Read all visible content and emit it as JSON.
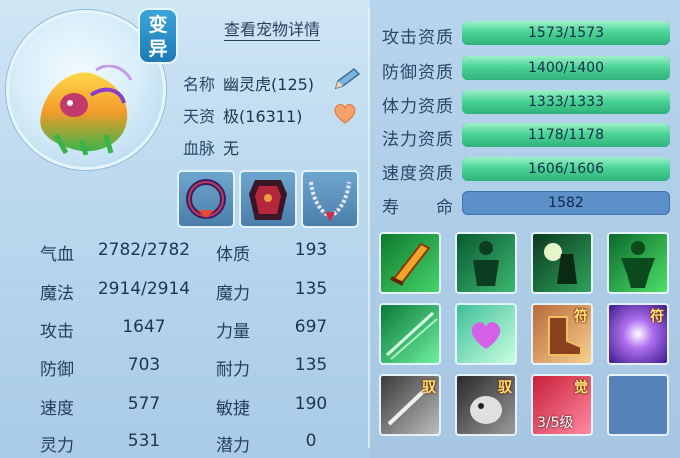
{
  "pet": {
    "mutation_badge": "变异",
    "detail_link": "查看宠物详情",
    "name_label": "名称",
    "name_value": "幽灵虎(125)",
    "aptitude_label": "天资",
    "aptitude_value": "极(16311)",
    "bloodline_label": "血脉",
    "bloodline_value": "无"
  },
  "stats": {
    "hp_label": "气血",
    "hp_value": "2782/2782",
    "mp_label": "魔法",
    "mp_value": "2914/2914",
    "atk_label": "攻击",
    "atk_value": "1647",
    "def_label": "防御",
    "def_value": "703",
    "spd_label": "速度",
    "spd_value": "577",
    "spirit_label": "灵力",
    "spirit_value": "531",
    "con_label": "体质",
    "con_value": "193",
    "int_label": "魔力",
    "int_value": "135",
    "str_label": "力量",
    "str_value": "697",
    "end_label": "耐力",
    "end_value": "135",
    "agi_label": "敏捷",
    "agi_value": "190",
    "pot_label": "潜力",
    "pot_value": "0"
  },
  "aptitudes": [
    {
      "label": "攻击资质",
      "text": "1573/1573",
      "fill": 1.0
    },
    {
      "label": "防御资质",
      "text": "1400/1400",
      "fill": 1.0
    },
    {
      "label": "体力资质",
      "text": "1333/1333",
      "fill": 1.0
    },
    {
      "label": "法力资质",
      "text": "1178/1178",
      "fill": 1.0
    },
    {
      "label": "速度资质",
      "text": "1606/1606",
      "fill": 1.0
    },
    {
      "label": "寿　　命",
      "text": "1582",
      "fill": 0
    }
  ],
  "skills": [
    {
      "icon": "flaming-sword-icon"
    },
    {
      "icon": "green-figure-icon"
    },
    {
      "icon": "moon-warrior-icon"
    },
    {
      "icon": "muscle-figure-icon"
    },
    {
      "icon": "green-burst-icon"
    },
    {
      "icon": "heart-glow-icon"
    },
    {
      "icon": "boot-icon",
      "tag": "符"
    },
    {
      "icon": "purple-burst-icon",
      "tag": "符"
    },
    {
      "icon": "grey-slash-icon",
      "tag": "驭"
    },
    {
      "icon": "grey-beast-icon",
      "tag": "驭"
    },
    {
      "icon": "awaken-icon",
      "tag": "觉",
      "level": "3/5级"
    },
    {
      "icon": "empty-slot"
    }
  ],
  "colors": {
    "bar_fill": "#4cd497",
    "bar_empty": "#5d8fc8",
    "tag": "#ffe07a"
  }
}
